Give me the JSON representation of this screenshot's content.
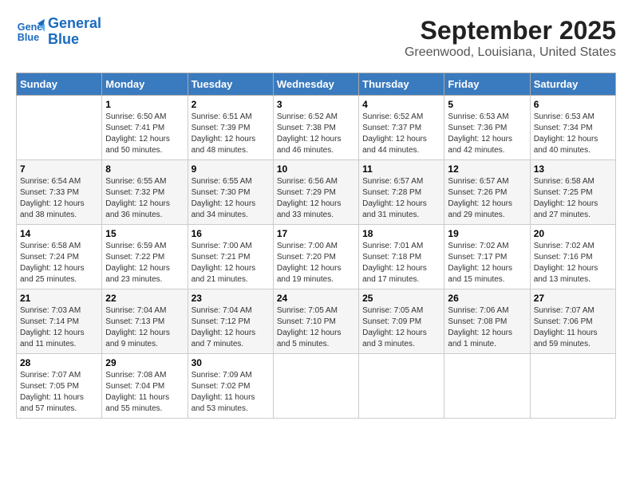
{
  "header": {
    "logo_line1": "General",
    "logo_line2": "Blue",
    "month": "September 2025",
    "location": "Greenwood, Louisiana, United States"
  },
  "weekdays": [
    "Sunday",
    "Monday",
    "Tuesday",
    "Wednesday",
    "Thursday",
    "Friday",
    "Saturday"
  ],
  "weeks": [
    [
      {
        "day": "",
        "sunrise": "",
        "sunset": "",
        "daylight": ""
      },
      {
        "day": "1",
        "sunrise": "Sunrise: 6:50 AM",
        "sunset": "Sunset: 7:41 PM",
        "daylight": "Daylight: 12 hours and 50 minutes."
      },
      {
        "day": "2",
        "sunrise": "Sunrise: 6:51 AM",
        "sunset": "Sunset: 7:39 PM",
        "daylight": "Daylight: 12 hours and 48 minutes."
      },
      {
        "day": "3",
        "sunrise": "Sunrise: 6:52 AM",
        "sunset": "Sunset: 7:38 PM",
        "daylight": "Daylight: 12 hours and 46 minutes."
      },
      {
        "day": "4",
        "sunrise": "Sunrise: 6:52 AM",
        "sunset": "Sunset: 7:37 PM",
        "daylight": "Daylight: 12 hours and 44 minutes."
      },
      {
        "day": "5",
        "sunrise": "Sunrise: 6:53 AM",
        "sunset": "Sunset: 7:36 PM",
        "daylight": "Daylight: 12 hours and 42 minutes."
      },
      {
        "day": "6",
        "sunrise": "Sunrise: 6:53 AM",
        "sunset": "Sunset: 7:34 PM",
        "daylight": "Daylight: 12 hours and 40 minutes."
      }
    ],
    [
      {
        "day": "7",
        "sunrise": "Sunrise: 6:54 AM",
        "sunset": "Sunset: 7:33 PM",
        "daylight": "Daylight: 12 hours and 38 minutes."
      },
      {
        "day": "8",
        "sunrise": "Sunrise: 6:55 AM",
        "sunset": "Sunset: 7:32 PM",
        "daylight": "Daylight: 12 hours and 36 minutes."
      },
      {
        "day": "9",
        "sunrise": "Sunrise: 6:55 AM",
        "sunset": "Sunset: 7:30 PM",
        "daylight": "Daylight: 12 hours and 34 minutes."
      },
      {
        "day": "10",
        "sunrise": "Sunrise: 6:56 AM",
        "sunset": "Sunset: 7:29 PM",
        "daylight": "Daylight: 12 hours and 33 minutes."
      },
      {
        "day": "11",
        "sunrise": "Sunrise: 6:57 AM",
        "sunset": "Sunset: 7:28 PM",
        "daylight": "Daylight: 12 hours and 31 minutes."
      },
      {
        "day": "12",
        "sunrise": "Sunrise: 6:57 AM",
        "sunset": "Sunset: 7:26 PM",
        "daylight": "Daylight: 12 hours and 29 minutes."
      },
      {
        "day": "13",
        "sunrise": "Sunrise: 6:58 AM",
        "sunset": "Sunset: 7:25 PM",
        "daylight": "Daylight: 12 hours and 27 minutes."
      }
    ],
    [
      {
        "day": "14",
        "sunrise": "Sunrise: 6:58 AM",
        "sunset": "Sunset: 7:24 PM",
        "daylight": "Daylight: 12 hours and 25 minutes."
      },
      {
        "day": "15",
        "sunrise": "Sunrise: 6:59 AM",
        "sunset": "Sunset: 7:22 PM",
        "daylight": "Daylight: 12 hours and 23 minutes."
      },
      {
        "day": "16",
        "sunrise": "Sunrise: 7:00 AM",
        "sunset": "Sunset: 7:21 PM",
        "daylight": "Daylight: 12 hours and 21 minutes."
      },
      {
        "day": "17",
        "sunrise": "Sunrise: 7:00 AM",
        "sunset": "Sunset: 7:20 PM",
        "daylight": "Daylight: 12 hours and 19 minutes."
      },
      {
        "day": "18",
        "sunrise": "Sunrise: 7:01 AM",
        "sunset": "Sunset: 7:18 PM",
        "daylight": "Daylight: 12 hours and 17 minutes."
      },
      {
        "day": "19",
        "sunrise": "Sunrise: 7:02 AM",
        "sunset": "Sunset: 7:17 PM",
        "daylight": "Daylight: 12 hours and 15 minutes."
      },
      {
        "day": "20",
        "sunrise": "Sunrise: 7:02 AM",
        "sunset": "Sunset: 7:16 PM",
        "daylight": "Daylight: 12 hours and 13 minutes."
      }
    ],
    [
      {
        "day": "21",
        "sunrise": "Sunrise: 7:03 AM",
        "sunset": "Sunset: 7:14 PM",
        "daylight": "Daylight: 12 hours and 11 minutes."
      },
      {
        "day": "22",
        "sunrise": "Sunrise: 7:04 AM",
        "sunset": "Sunset: 7:13 PM",
        "daylight": "Daylight: 12 hours and 9 minutes."
      },
      {
        "day": "23",
        "sunrise": "Sunrise: 7:04 AM",
        "sunset": "Sunset: 7:12 PM",
        "daylight": "Daylight: 12 hours and 7 minutes."
      },
      {
        "day": "24",
        "sunrise": "Sunrise: 7:05 AM",
        "sunset": "Sunset: 7:10 PM",
        "daylight": "Daylight: 12 hours and 5 minutes."
      },
      {
        "day": "25",
        "sunrise": "Sunrise: 7:05 AM",
        "sunset": "Sunset: 7:09 PM",
        "daylight": "Daylight: 12 hours and 3 minutes."
      },
      {
        "day": "26",
        "sunrise": "Sunrise: 7:06 AM",
        "sunset": "Sunset: 7:08 PM",
        "daylight": "Daylight: 12 hours and 1 minute."
      },
      {
        "day": "27",
        "sunrise": "Sunrise: 7:07 AM",
        "sunset": "Sunset: 7:06 PM",
        "daylight": "Daylight: 11 hours and 59 minutes."
      }
    ],
    [
      {
        "day": "28",
        "sunrise": "Sunrise: 7:07 AM",
        "sunset": "Sunset: 7:05 PM",
        "daylight": "Daylight: 11 hours and 57 minutes."
      },
      {
        "day": "29",
        "sunrise": "Sunrise: 7:08 AM",
        "sunset": "Sunset: 7:04 PM",
        "daylight": "Daylight: 11 hours and 55 minutes."
      },
      {
        "day": "30",
        "sunrise": "Sunrise: 7:09 AM",
        "sunset": "Sunset: 7:02 PM",
        "daylight": "Daylight: 11 hours and 53 minutes."
      },
      {
        "day": "",
        "sunrise": "",
        "sunset": "",
        "daylight": ""
      },
      {
        "day": "",
        "sunrise": "",
        "sunset": "",
        "daylight": ""
      },
      {
        "day": "",
        "sunrise": "",
        "sunset": "",
        "daylight": ""
      },
      {
        "day": "",
        "sunrise": "",
        "sunset": "",
        "daylight": ""
      }
    ]
  ]
}
